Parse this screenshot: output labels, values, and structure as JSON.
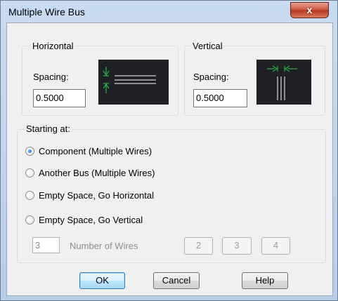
{
  "window": {
    "title": "Multiple Wire Bus",
    "close_glyph": "x"
  },
  "horizontal": {
    "legend": "Horizontal",
    "spacing_label": "Spacing:",
    "spacing_value": "0.5000"
  },
  "vertical": {
    "legend": "Vertical",
    "spacing_label": "Spacing:",
    "spacing_value": "0.5000"
  },
  "starting_at": {
    "legend": "Starting at:",
    "options": [
      {
        "label": "Component (Multiple Wires)",
        "checked": true
      },
      {
        "label": "Another Bus (Multiple Wires)",
        "checked": false
      },
      {
        "label": "Empty Space, Go Horizontal",
        "checked": false
      },
      {
        "label": "Empty Space, Go Vertical",
        "checked": false
      }
    ]
  },
  "wires": {
    "count_value": "3",
    "label": "Number of Wires",
    "preset_buttons": [
      "2",
      "3",
      "4"
    ]
  },
  "footer": {
    "ok_label": "OK",
    "cancel_label": "Cancel",
    "help_label": "Help"
  },
  "colors": {
    "preview_bg": "#1f2026",
    "preview_line": "#ffffff",
    "preview_accent": "#2ad14a"
  }
}
